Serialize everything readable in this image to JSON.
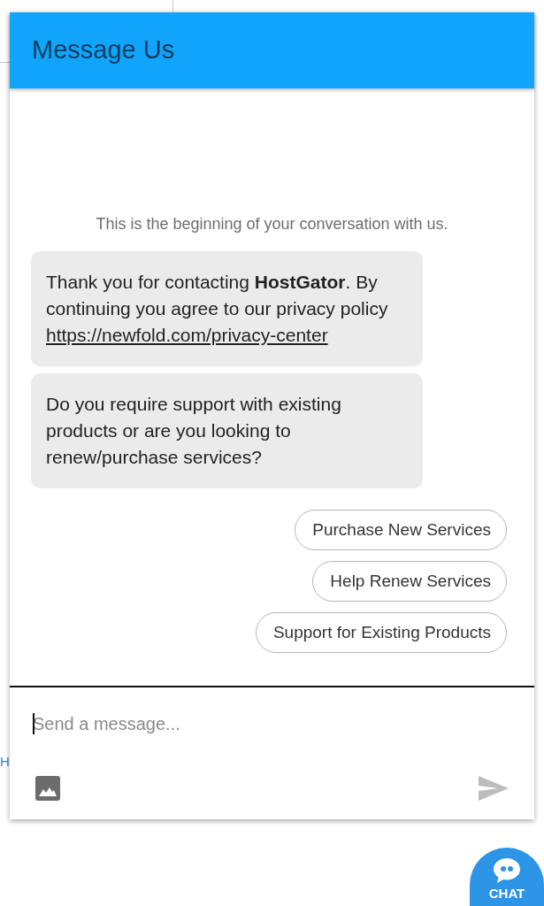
{
  "background": {
    "link_fragment": "H"
  },
  "header": {
    "title": "Message Us"
  },
  "conversation": {
    "intro": "This is the beginning of your conversation with us.",
    "messages": [
      {
        "text": "Thank you for contacting **HostGator**. By continuing you agree to our privacy policy",
        "link": "https://newfold.com/privacy-center"
      },
      {
        "text": "Do you require support with existing products or are you looking to renew/purchase services?"
      }
    ],
    "quick_replies": [
      "Purchase New Services",
      "Help Renew Services",
      "Support for Existing Products"
    ]
  },
  "composer": {
    "placeholder": "Send a message...",
    "focused": true
  },
  "chat_button": {
    "label": "CHAT"
  }
}
